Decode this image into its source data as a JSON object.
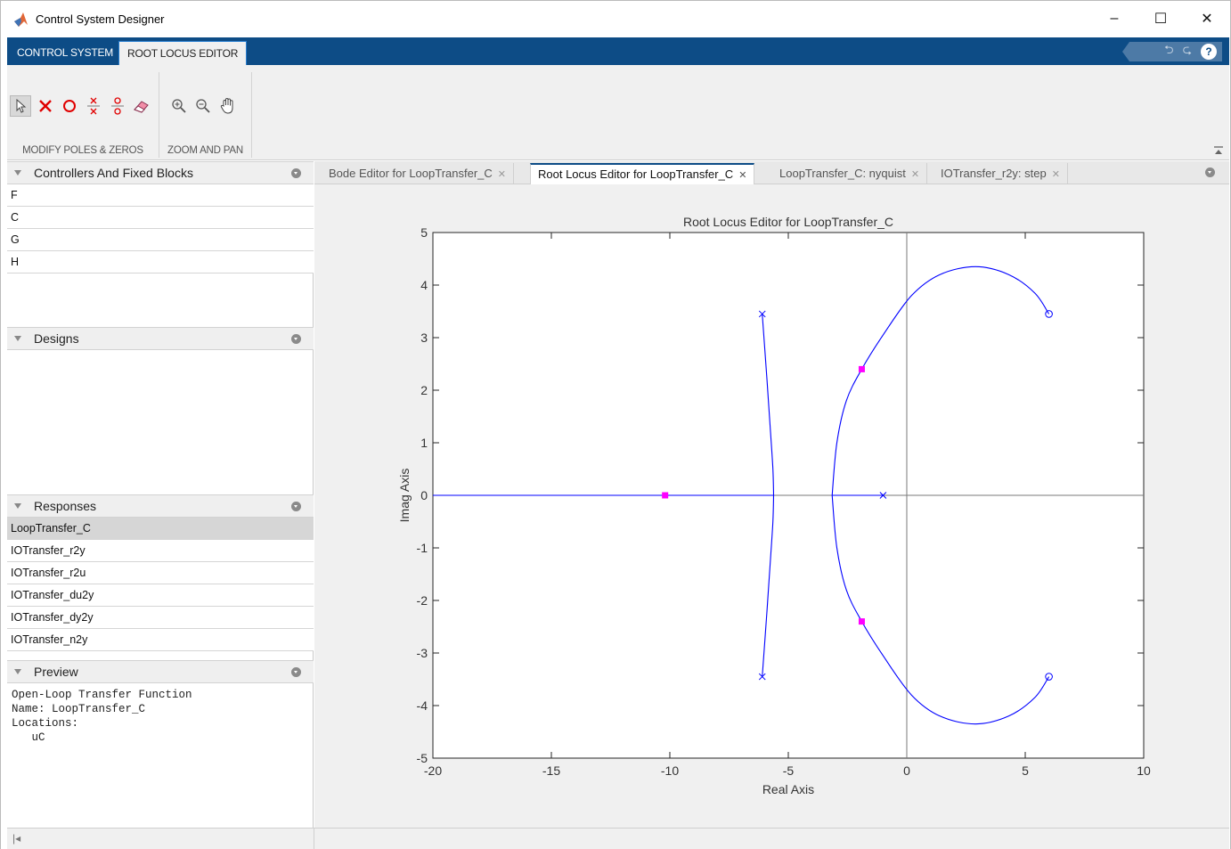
{
  "window": {
    "title": "Control System Designer",
    "minimize": "–",
    "maximize": "☐",
    "close": "✕"
  },
  "ribbon": {
    "tabs": [
      "CONTROL SYSTEM",
      "ROOT LOCUS EDITOR"
    ],
    "active_tab": "ROOT LOCUS EDITOR",
    "quick_access": {
      "undo": "⮌",
      "redo": "⮎",
      "help": "?"
    },
    "sections": [
      {
        "label": "MODIFY POLES & ZEROS",
        "tools": [
          "select-arrow-icon",
          "add-real-pole-icon",
          "add-real-zero-icon",
          "add-complex-pole-icon",
          "add-complex-zero-icon",
          "eraser-icon"
        ]
      },
      {
        "label": "ZOOM AND PAN",
        "tools": [
          "zoom-in-icon",
          "zoom-out-icon",
          "pan-hand-icon"
        ]
      }
    ],
    "accent_color": "#0d4c86"
  },
  "panels": {
    "controllers": {
      "title": "Controllers And Fixed Blocks",
      "items": [
        "F",
        "C",
        "G",
        "H"
      ]
    },
    "designs": {
      "title": "Designs",
      "items": []
    },
    "responses": {
      "title": "Responses",
      "items": [
        "LoopTransfer_C",
        "IOTransfer_r2y",
        "IOTransfer_r2u",
        "IOTransfer_du2y",
        "IOTransfer_dy2y",
        "IOTransfer_n2y"
      ],
      "selected": "LoopTransfer_C"
    },
    "preview": {
      "title": "Preview",
      "text": "Open-Loop Transfer Function\nName: LoopTransfer_C\nLocations:\n   uC"
    }
  },
  "doc_tabs": [
    {
      "label": "Bode Editor for LoopTransfer_C",
      "active": false
    },
    {
      "label": "Root Locus Editor for LoopTransfer_C",
      "active": true
    },
    {
      "label": "LoopTransfer_C: nyquist",
      "active": false
    },
    {
      "label": "IOTransfer_r2y: step",
      "active": false
    }
  ],
  "chart_data": {
    "type": "line",
    "title": "Root Locus Editor for LoopTransfer_C",
    "xlabel": "Real Axis",
    "ylabel": "Imag Axis",
    "xlim": [
      -20,
      10
    ],
    "ylim": [
      -5,
      5
    ],
    "xticks": [
      -20,
      -15,
      -10,
      -5,
      0,
      5,
      10
    ],
    "yticks": [
      5,
      4,
      3,
      2,
      1,
      0,
      -1,
      -2,
      -3,
      -4,
      -5
    ],
    "grid": false,
    "locus_color": "#0000ff",
    "marker_color": "#ff00ff",
    "poles": [
      {
        "x": -6.1,
        "y": 3.45
      },
      {
        "x": -6.1,
        "y": -3.45
      },
      {
        "x": -1.0,
        "y": 0
      }
    ],
    "zeros": [
      {
        "x": 6.0,
        "y": 3.45
      },
      {
        "x": 6.0,
        "y": -3.45
      }
    ],
    "closed_loop_poles": [
      {
        "x": -10.2,
        "y": 0
      },
      {
        "x": -1.9,
        "y": 2.4
      },
      {
        "x": -1.9,
        "y": -2.4
      }
    ],
    "series": [
      {
        "x": [
          -20,
          -5.6
        ],
        "y": [
          0,
          0
        ]
      },
      {
        "x": [
          -6.1,
          -5.9,
          -5.75,
          -5.65,
          -5.62
        ],
        "y": [
          3.45,
          2.2,
          1.2,
          0.5,
          0
        ]
      },
      {
        "x": [
          -6.1,
          -5.9,
          -5.75,
          -5.65,
          -5.62
        ],
        "y": [
          -3.45,
          -2.2,
          -1.2,
          -0.5,
          0
        ]
      },
      {
        "x": [
          -1.0,
          -3.15
        ],
        "y": [
          0,
          0
        ]
      },
      {
        "x": [
          -3.15,
          -2.95,
          -2.55,
          -1.9,
          -1.0,
          0.2,
          1.4,
          2.9,
          4.3,
          5.4,
          6.0
        ],
        "y": [
          0,
          1.0,
          1.8,
          2.4,
          3.05,
          3.8,
          4.2,
          4.35,
          4.2,
          3.85,
          3.45
        ]
      },
      {
        "x": [
          -3.15,
          -2.95,
          -2.55,
          -1.9,
          -1.0,
          0.2,
          1.4,
          2.9,
          4.3,
          5.4,
          6.0
        ],
        "y": [
          0,
          -1.0,
          -1.8,
          -2.4,
          -3.05,
          -3.8,
          -4.2,
          -4.35,
          -4.2,
          -3.85,
          -3.45
        ]
      }
    ]
  },
  "statusbar": {
    "pin": "|◂"
  }
}
